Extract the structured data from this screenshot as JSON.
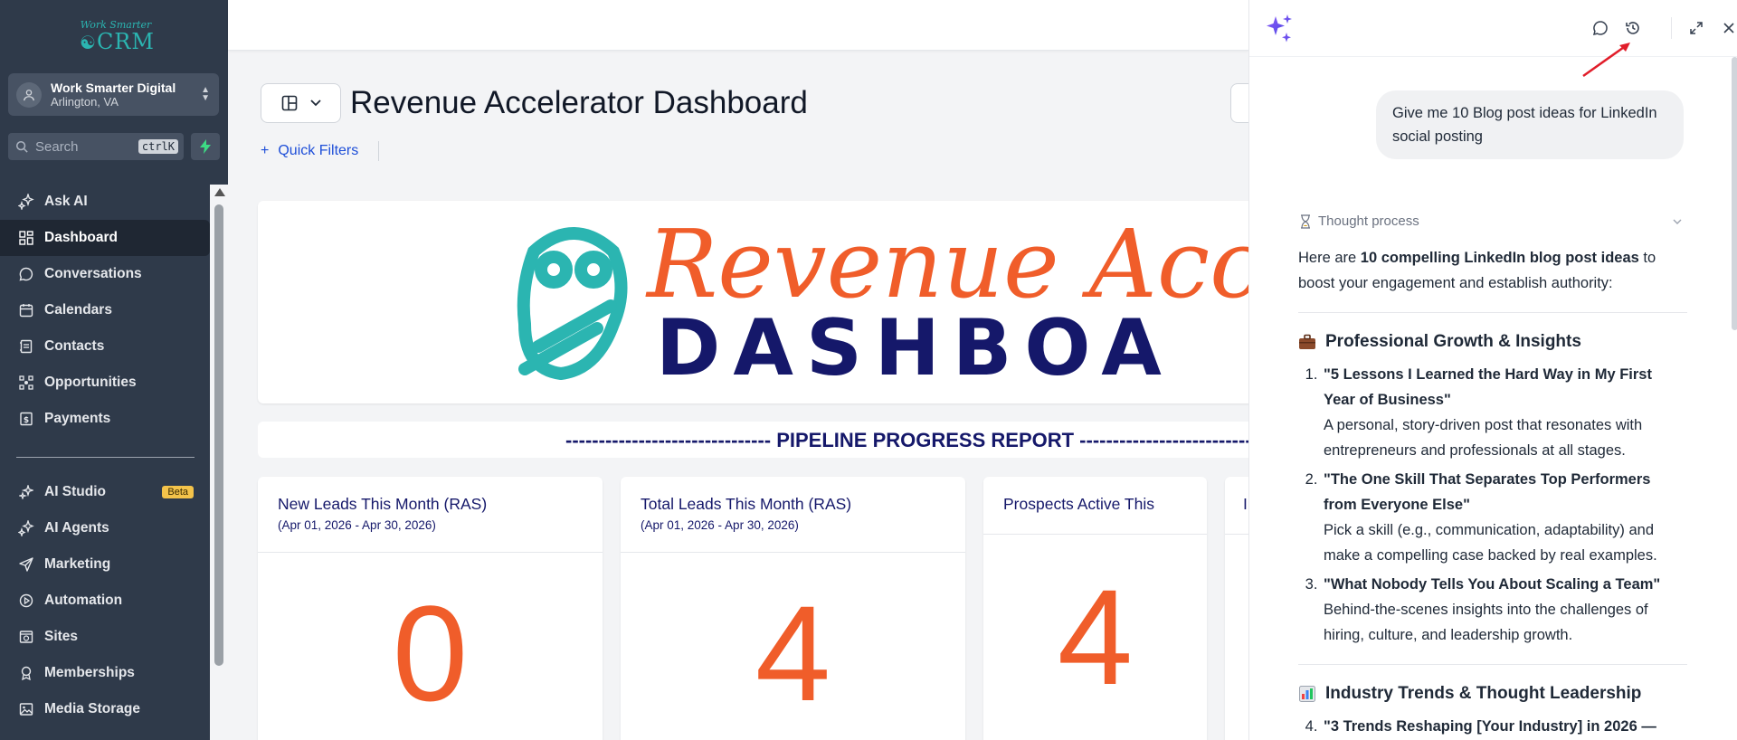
{
  "sidebar": {
    "logo": {
      "line1": "Work Smarter",
      "line2": "CRM"
    },
    "account": {
      "name": "Work Smarter Digital",
      "location": "Arlington, VA"
    },
    "search": {
      "placeholder": "Search",
      "shortcut": "ctrlK"
    },
    "nav": [
      {
        "label": "Ask AI",
        "icon": "sparkle-icon"
      },
      {
        "label": "Dashboard",
        "icon": "grid-icon",
        "active": true
      },
      {
        "label": "Conversations",
        "icon": "chat-icon"
      },
      {
        "label": "Calendars",
        "icon": "calendar-icon"
      },
      {
        "label": "Contacts",
        "icon": "contacts-icon"
      },
      {
        "label": "Opportunities",
        "icon": "opportunities-icon"
      },
      {
        "label": "Payments",
        "icon": "payments-icon"
      }
    ],
    "nav2": [
      {
        "label": "AI Studio",
        "icon": "ai-studio-icon",
        "badge": "Beta"
      },
      {
        "label": "AI Agents",
        "icon": "sparkle-icon"
      },
      {
        "label": "Marketing",
        "icon": "send-icon"
      },
      {
        "label": "Automation",
        "icon": "automation-icon"
      },
      {
        "label": "Sites",
        "icon": "sites-icon"
      },
      {
        "label": "Memberships",
        "icon": "award-icon"
      },
      {
        "label": "Media Storage",
        "icon": "image-icon"
      }
    ]
  },
  "main": {
    "title": "Revenue Accelerator Dashboard",
    "quick_filters": "Quick Filters",
    "banner": {
      "line1": "Revenue Acceler",
      "line2": "DASHBOA"
    },
    "pipeline": "------------------------------- PIPELINE PROGRESS REPORT -------------------------------",
    "cards": [
      {
        "title": "New Leads This Month (RAS)",
        "date": "(Apr 01, 2026 - Apr 30, 2026)",
        "value": "0"
      },
      {
        "title": "Total Leads This Month (RAS)",
        "date": "(Apr 01, 2026 - Apr 30, 2026)",
        "value": "4"
      },
      {
        "title": "Prospects Active This",
        "date": "",
        "value": "4"
      },
      {
        "title": "I",
        "date": "",
        "value": ""
      }
    ]
  },
  "panel": {
    "user_message": "Give me 10 Blog post ideas for LinkedIn social posting",
    "thought_label": "Thought process",
    "intro_pre": "Here are ",
    "intro_bold": "10 compelling LinkedIn blog post ideas",
    "intro_post": " to boost your engagement and establish authority:",
    "section1": {
      "emoji": "briefcase-icon",
      "title": "Professional Growth & Insights"
    },
    "ideas1": [
      {
        "title": "\"5 Lessons I Learned the Hard Way in My First Year of Business\"",
        "desc": "A personal, story-driven post that resonates with entrepreneurs and professionals at all stages."
      },
      {
        "title": "\"The One Skill That Separates Top Performers from Everyone Else\"",
        "desc": "Pick a skill (e.g., communication, adaptability) and make a compelling case backed by real examples."
      },
      {
        "title": "\"What Nobody Tells You About Scaling a Team\"",
        "desc": "Behind-the-scenes insights into the challenges of hiring, culture, and leadership growth."
      }
    ],
    "section2": {
      "emoji": "bar-chart-icon",
      "title": "Industry Trends & Thought Leadership"
    },
    "ideas2_first": "\"3 Trends Reshaping [Your Industry] in 2026 —"
  },
  "colors": {
    "sidebar": "#2f3a4a",
    "accent": "#f05d2a",
    "navy": "#15186a",
    "teal": "#2bb5b1",
    "link": "#1d4ed8"
  }
}
